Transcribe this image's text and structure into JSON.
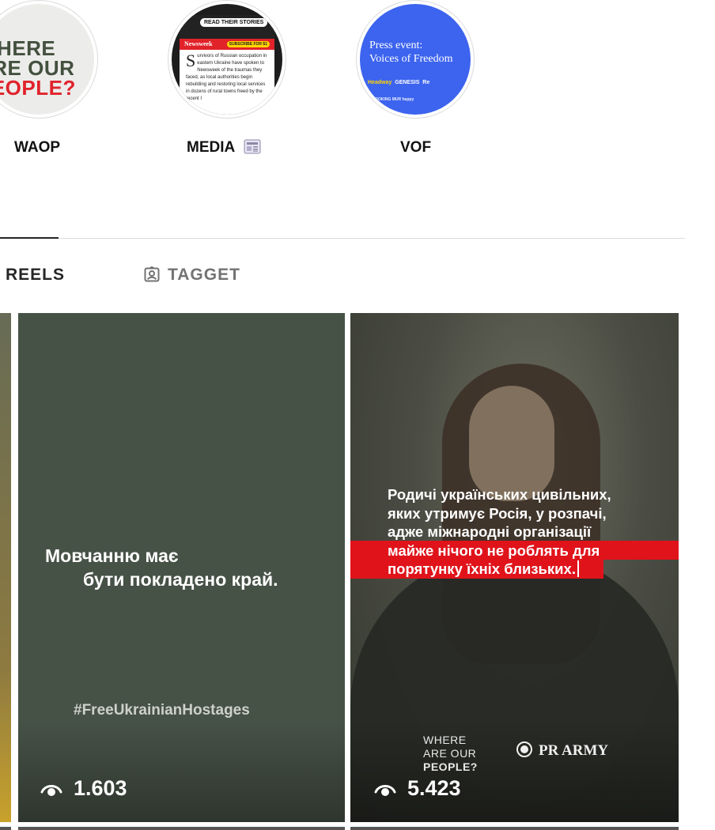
{
  "highlights": [
    {
      "label": "WAOP",
      "cover_lines": [
        "WHERE",
        "ARE OUR",
        "PEOPLE?"
      ]
    },
    {
      "label": "MEDIA",
      "cover": {
        "pill": "READ THEIR STORIES",
        "logo": "Newsweek",
        "subscribe": "SUBSCRIBE FOR $1",
        "dropcap": "S",
        "article": "urvivors of Russian occupation in eastern Ukraine have spoken to Newsweek of the traumas they faced, as local authorities begin rebuilding and restoring local services in dozens of rural towns freed by the recent I"
      }
    },
    {
      "label": "VOF",
      "cover": {
        "title_line1": "Press event:",
        "title_line2": "Voices of Freedom",
        "logos": "Headway",
        "logos2": "GENESIS",
        "logos3": "Re",
        "logos_row2": "LOOKING  MUR  happy"
      }
    }
  ],
  "tabs": {
    "reels": "REELS",
    "tagged": "TAGGET"
  },
  "reels": [
    {
      "text_line1": "Мовчанню має",
      "text_line2": "бути покладено край.",
      "hashtag": "#FreeUkrainianHostages",
      "views": "1.603"
    },
    {
      "text_lines": [
        "Родичі українських цивільних,",
        "яких утримує Росія, у розпачі,",
        "адже міжнародні організації"
      ],
      "line4_plain": "майже ",
      "line4_red": "нічого не роблять для",
      "line5_red": "порятунку їхніх близьких.",
      "brand_lines": [
        "WHERE",
        "ARE OUR",
        "PEOPLE?"
      ],
      "partner": "PR ARMY",
      "views": "5.423"
    }
  ],
  "colors": {
    "accent_red": "#e0131b",
    "reel_green": "#475247",
    "vof_blue": "#3d64ef"
  }
}
